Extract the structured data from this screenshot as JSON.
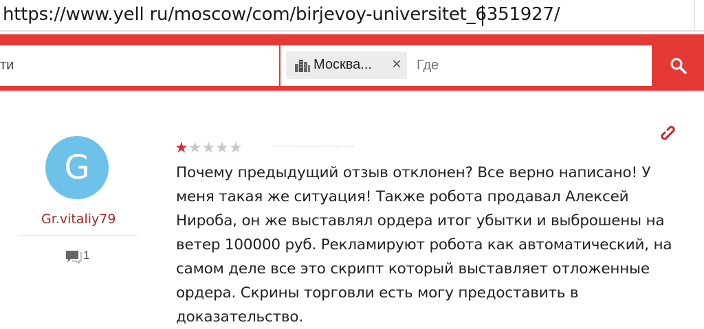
{
  "browser": {
    "url": "https://www.yell ru/moscow/com/birjevoy-universitet_6351927/"
  },
  "search": {
    "what_value": "ти",
    "location_chip": "Москва...",
    "location_chip_close": "×",
    "where_placeholder": "Где",
    "search_icon": "search-icon",
    "accent_color": "#e53935"
  },
  "review": {
    "avatar_letter": "G",
    "avatar_color": "#6ec1e8",
    "username": "Gr.vitaliy79",
    "comment_count": "1",
    "rating": 1,
    "rating_max": 5,
    "star_full": "★",
    "star_empty": "★",
    "text": "Почему предыдущий отзыв отклонен? Все верно написано! У меня такая же ситуация! Также робота продавал Алексей Нироба, он же выставлял ордера итог убытки и выброшены на ветер 100000 руб. Рекламируют робота как автоматический, на самом деле все это скрипт который выставляет отложенные ордера. Скрины торговли есть могу предоставить в доказательство."
  }
}
